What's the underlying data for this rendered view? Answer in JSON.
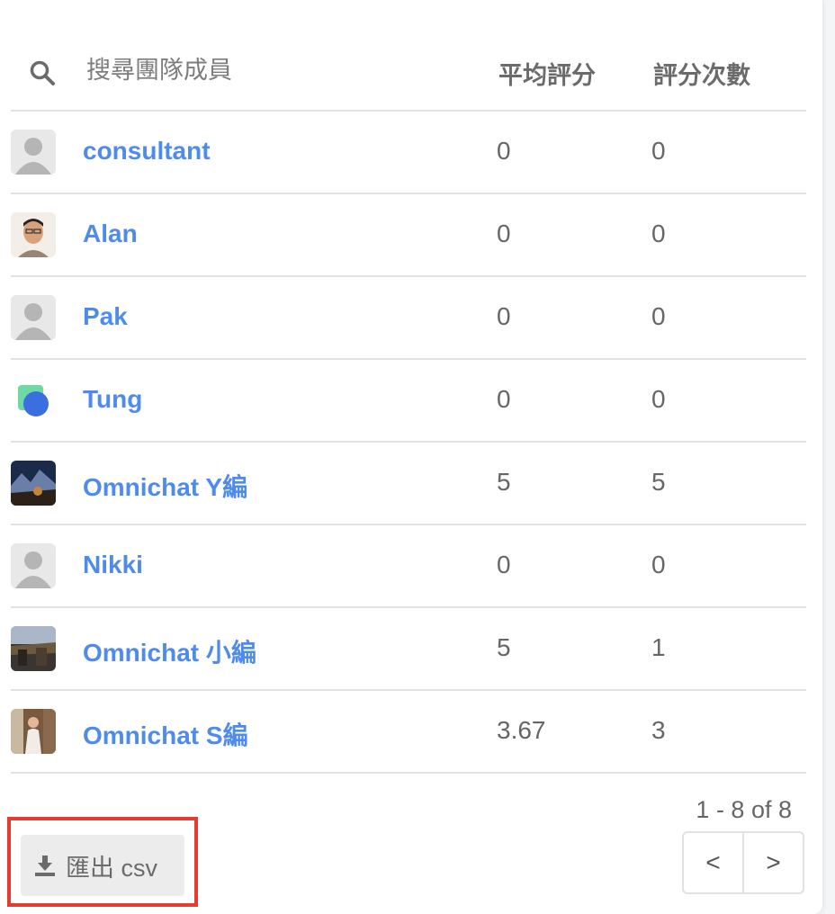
{
  "search": {
    "placeholder": "搜尋團隊成員"
  },
  "columns": {
    "avg_rating": "平均評分",
    "rating_count": "評分次數"
  },
  "members": [
    {
      "name": "consultant",
      "avatar": "default-avatar",
      "avg": "0",
      "count": "0"
    },
    {
      "name": "Alan",
      "avatar": "photo-avatar",
      "avg": "0",
      "count": "0"
    },
    {
      "name": "Pak",
      "avatar": "default-avatar",
      "avg": "0",
      "count": "0"
    },
    {
      "name": "Tung",
      "avatar": "logo-avatar",
      "avg": "0",
      "count": "0"
    },
    {
      "name": "Omnichat Y編",
      "avatar": "photo-avatar",
      "avg": "5",
      "count": "5"
    },
    {
      "name": "Nikki",
      "avatar": "default-avatar",
      "avg": "0",
      "count": "0"
    },
    {
      "name": "Omnichat 小編",
      "avatar": "photo-avatar",
      "avg": "5",
      "count": "1"
    },
    {
      "name": "Omnichat S編",
      "avatar": "photo-avatar",
      "avg": "3.67",
      "count": "3"
    }
  ],
  "pagination": {
    "range_text": "1 - 8 of 8",
    "prev_label": "<",
    "next_label": ">"
  },
  "export": {
    "label": "匯出 csv"
  },
  "colors": {
    "accent": "#4f8bea",
    "highlight": "#e63b2e",
    "divider": "#e1e1e1"
  }
}
